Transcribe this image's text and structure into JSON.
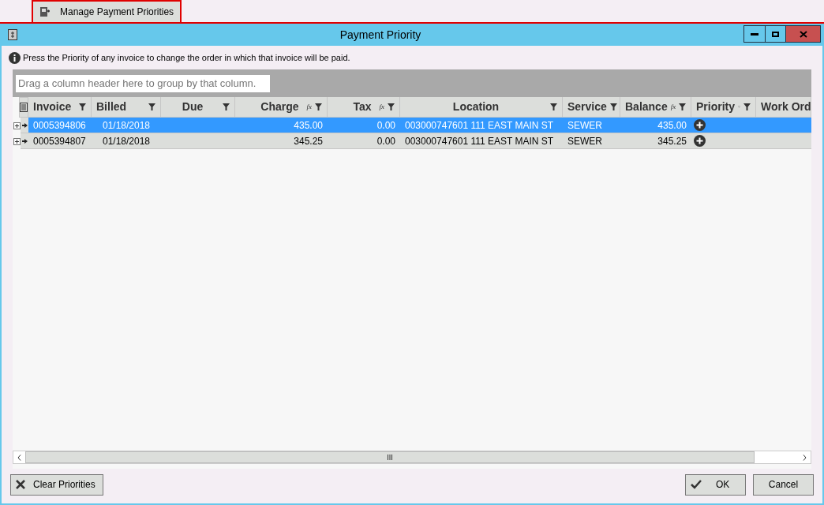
{
  "toolbar": {
    "button": "Manage Payment Priorities"
  },
  "window": {
    "title": "Payment Priority"
  },
  "info": "Press the Priority of any invoice to change the order in which that invoice will be paid.",
  "group_panel": {
    "placeholder": "Drag a column header here to group by that column."
  },
  "table": {
    "columns": [
      {
        "label": "Invoice",
        "sort_indicator": false,
        "filter": true
      },
      {
        "label": "Billed",
        "sort_indicator": false,
        "filter": true
      },
      {
        "label": "Due",
        "sort_indicator": false,
        "filter": true
      },
      {
        "label": "Charge",
        "formula": "fx",
        "sort_indicator": false,
        "filter": true
      },
      {
        "label": "Tax",
        "formula": "fx",
        "sort_indicator": false,
        "filter": true
      },
      {
        "label": "Location",
        "sort_indicator": false,
        "filter": true
      },
      {
        "label": "Service",
        "sort_indicator": false,
        "filter": true
      },
      {
        "label": "Balance",
        "formula": "fx",
        "sort_indicator": false,
        "filter": true
      },
      {
        "label": "Priority",
        "sort_indicator": true,
        "filter": true
      },
      {
        "label": "Work Ord"
      }
    ],
    "rows": [
      {
        "selected": true,
        "cells": [
          "0005394806",
          "01/18/2018",
          "",
          "435.00",
          "0.00",
          "003000747601 111 EAST MAIN ST",
          "SEWER",
          "435.00"
        ]
      },
      {
        "selected": false,
        "cells": [
          "0005394807",
          "01/18/2018",
          "",
          "345.25",
          "0.00",
          "003000747601 111 EAST MAIN ST",
          "SEWER",
          "345.25"
        ]
      }
    ]
  },
  "buttons": {
    "clear": "Clear Priorities",
    "ok": "OK",
    "cancel": "Cancel"
  }
}
